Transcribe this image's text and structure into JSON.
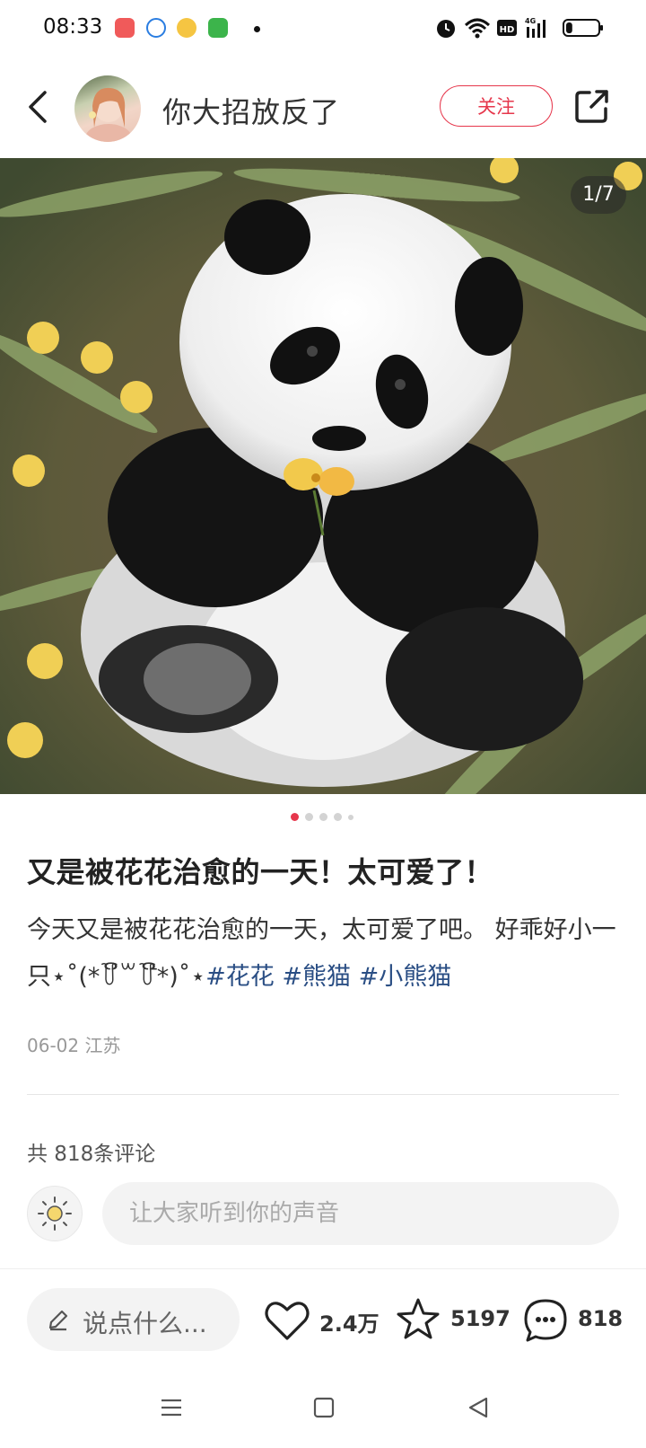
{
  "status_bar": {
    "time": "08:33",
    "battery_level": 0.2,
    "network_label": "HD",
    "signal_label": "4G"
  },
  "header": {
    "username": "你大招放反了",
    "follow_label": "关注"
  },
  "photo": {
    "counter": "1/7",
    "current_index": 1,
    "dots_count": 5
  },
  "post": {
    "title": "又是被花花治愈的一天！太可爱了！",
    "body": "今天又是被花花治愈的一天，太可爱了吧。 好乖好小一只⋆˚(*꒦ິ꒳꒦ີ*)˚⋆",
    "tags": [
      "#花花",
      "#熊猫",
      "#小熊猫"
    ],
    "meta": "06-02 江苏"
  },
  "comments": {
    "count_label": "共 818条评论",
    "input_placeholder": "让大家听到你的声音"
  },
  "bottom_bar": {
    "say_label": "说点什么...",
    "likes": "2.4万",
    "stars": "5197",
    "comments": "818"
  },
  "colors": {
    "accent": "#e6374c",
    "tag": "#2a4e84"
  }
}
